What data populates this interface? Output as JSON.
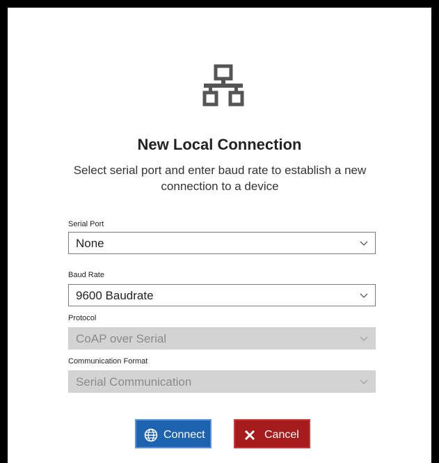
{
  "dialog": {
    "title": "New Local Connection",
    "subtitle": "Select serial port and enter baud rate to establish a new connection to a device",
    "icon": "network-icon"
  },
  "fields": {
    "serial_port": {
      "label": "Serial Port",
      "value": "None",
      "disabled": false
    },
    "baud_rate": {
      "label": "Baud Rate",
      "value": "9600 Baudrate",
      "disabled": false
    },
    "protocol": {
      "label": "Protocol",
      "value": "CoAP over Serial",
      "disabled": true
    },
    "communication_format": {
      "label": "Communication Format",
      "value": "Serial Communication",
      "disabled": true
    }
  },
  "buttons": {
    "connect": {
      "label": "Connect",
      "icon": "globe-icon",
      "color": "#1e63b0"
    },
    "cancel": {
      "label": "Cancel",
      "icon": "close-icon",
      "color": "#a61c1c"
    }
  },
  "colors": {
    "disabled_field_bg": "#d3d3d3",
    "disabled_field_text": "#8a8a8a"
  }
}
